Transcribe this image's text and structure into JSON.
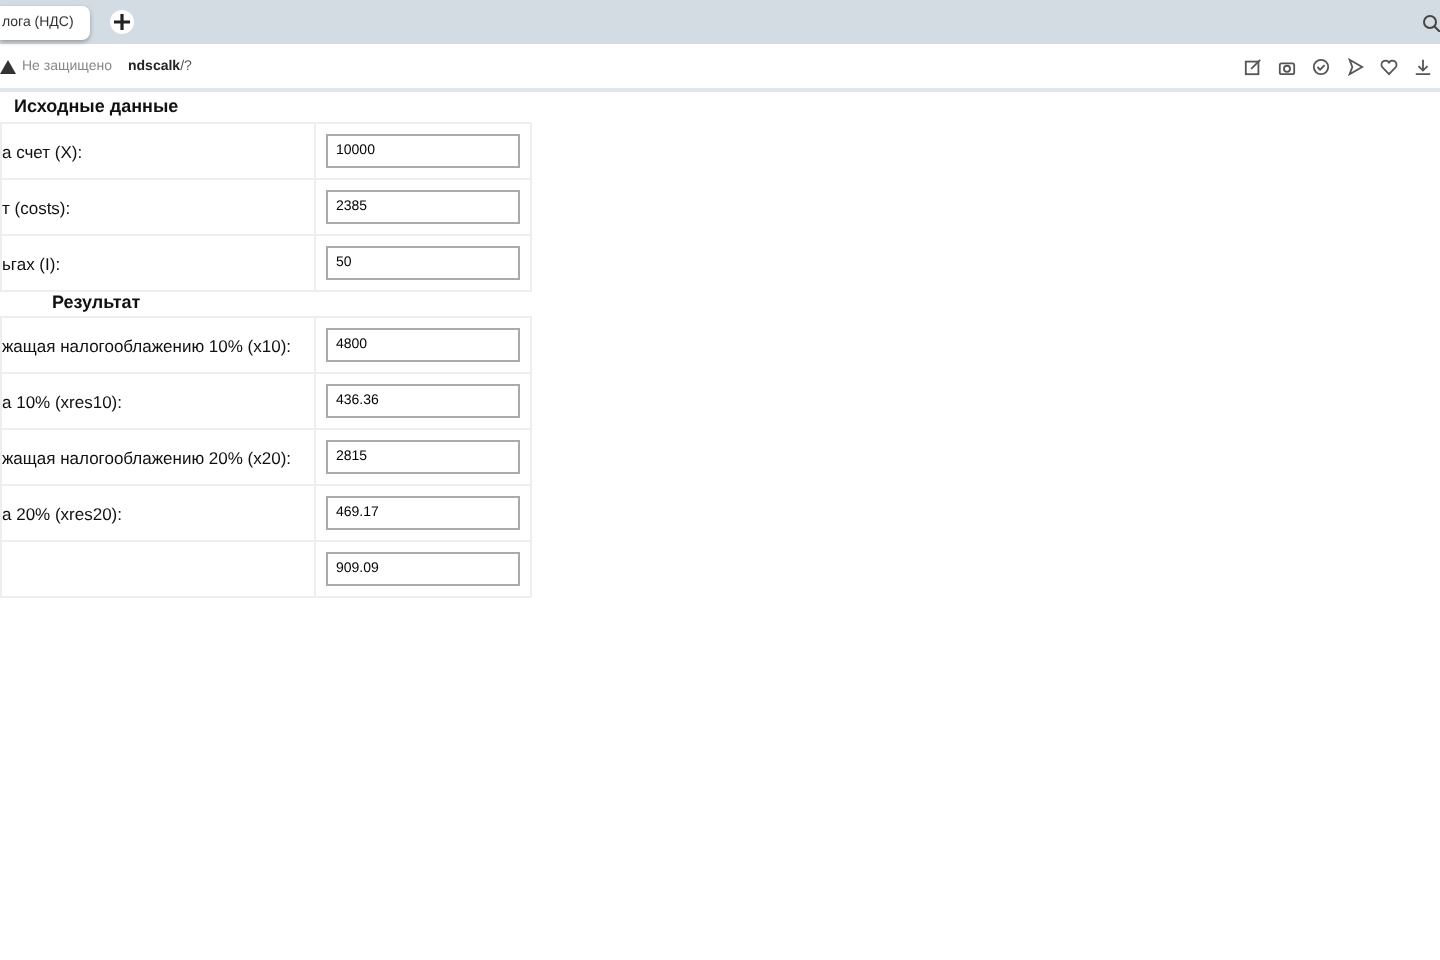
{
  "tab": {
    "title": "лога (НДС)",
    "selected": true
  },
  "address_bar": {
    "security": "Не защищено",
    "url_host": "ndscalk",
    "url_path": "/?"
  },
  "sections": [
    {
      "heading": "Исходные данные",
      "rows": [
        {
          "label": "а счет (X):",
          "value": "10000"
        },
        {
          "label": "т (costs):",
          "value": "2385"
        },
        {
          "label": "ьгах (I):",
          "value": "50"
        }
      ]
    },
    {
      "heading": "Результат",
      "rows": [
        {
          "label": "жащая налогооблажению 10% (x10):",
          "value": "4800"
        },
        {
          "label": "а 10% (xres10):",
          "value": "436.36"
        },
        {
          "label": "жащая налогооблажению 20% (x20):",
          "value": "2815"
        },
        {
          "label": "а 20% (xres20):",
          "value": "469.17"
        },
        {
          "label": "",
          "value": "909.09"
        }
      ]
    }
  ]
}
